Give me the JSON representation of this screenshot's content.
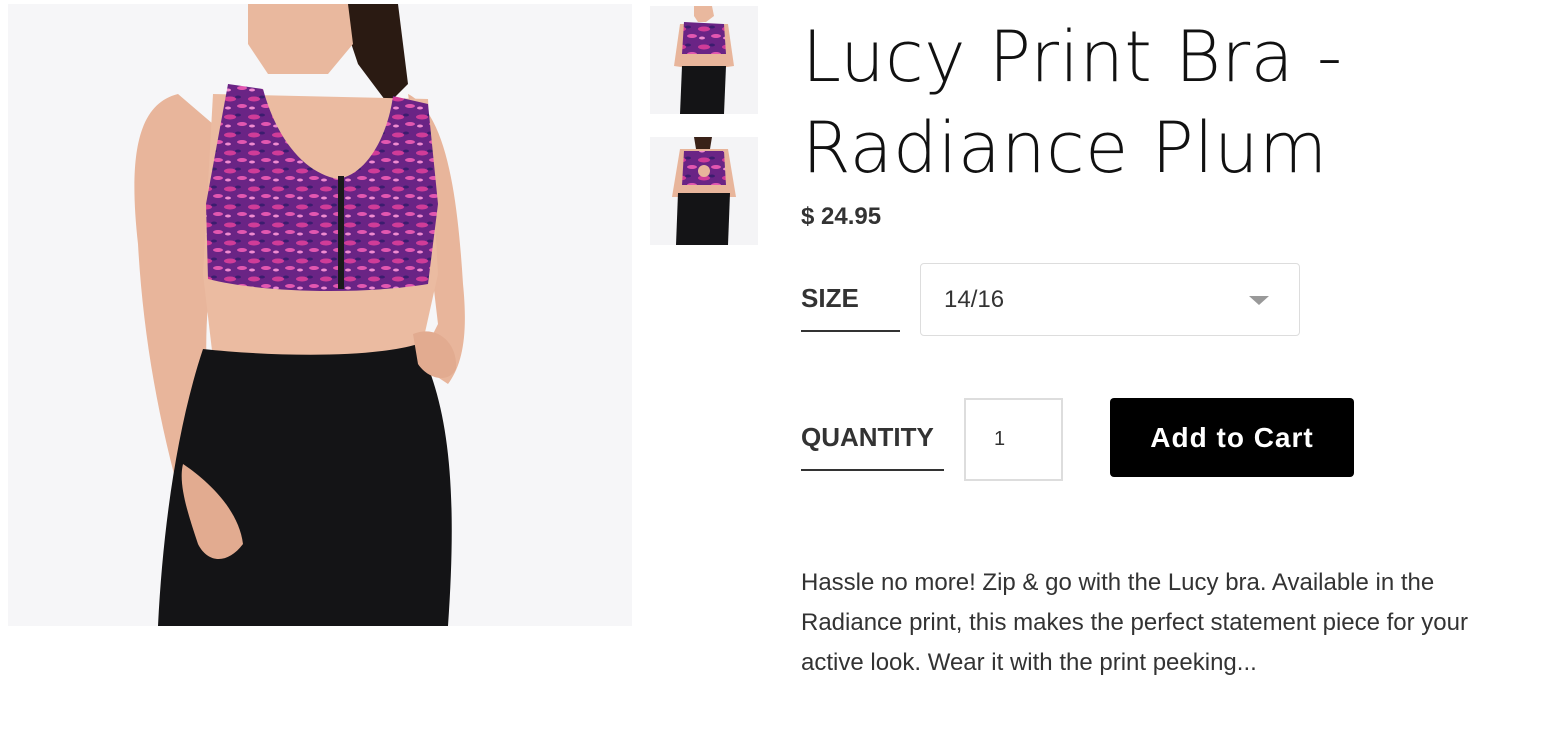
{
  "product": {
    "title": "Lucy Print Bra - Radiance Plum",
    "price": "$ 24.95",
    "description": "Hassle no more! Zip & go with the Lucy bra. Available in the Radiance print, this makes the perfect statement piece for your active look. Wear it with the print peeking..."
  },
  "options": {
    "size_label": "SIZE",
    "size_value": "14/16",
    "quantity_label": "QUANTITY",
    "quantity_value": "1"
  },
  "actions": {
    "add_to_cart": "Add to Cart"
  },
  "colors": {
    "print": "#7a2a8e",
    "print_pink": "#d43c9a",
    "leggings": "#141416",
    "skin": "#e8b9a0",
    "button": "#000000"
  }
}
